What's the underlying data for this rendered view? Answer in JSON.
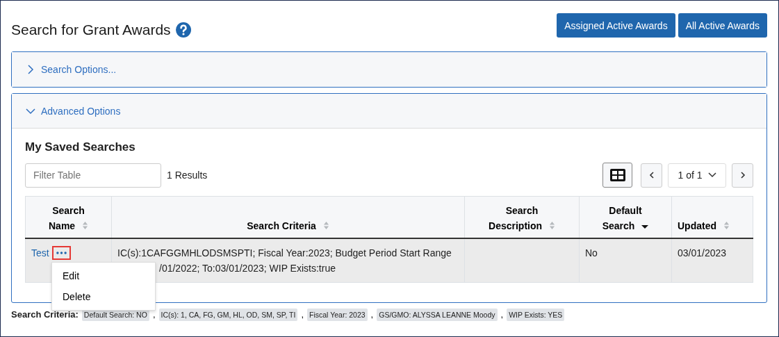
{
  "page": {
    "title": "Search for Grant Awards"
  },
  "header_buttons": [
    "Assigned Active Awards",
    "All Active Awards"
  ],
  "panels": [
    {
      "title": "Search Options...",
      "expanded": false
    },
    {
      "title": "Advanced Options",
      "expanded": true
    }
  ],
  "saved_searches": {
    "title": "My Saved Searches",
    "filter": {
      "placeholder": "Filter Table"
    },
    "results": "1 Results",
    "pager": "1 of 1",
    "columns": [
      {
        "label": "Search Name",
        "sorted_descending": false
      },
      {
        "label": "Search Criteria",
        "sorted_descending": false
      },
      {
        "label": "Search Description",
        "sorted_descending": false
      },
      {
        "label": "Default Search",
        "sorted_descending": true
      },
      {
        "label": "Updated",
        "sorted_descending": false
      }
    ],
    "rows": [
      {
        "name": "Test",
        "criteria": [
          "IC(s):1CAFGGMHLODSMSPTI; Fiscal Year:2023; Budget Period Start Range",
          "/01/2022; To:03/01/2023; WIP Exists:true"
        ],
        "default": "No",
        "updated": "03/01/2023"
      }
    ],
    "row_menu": {
      "open": true,
      "items": [
        "Edit",
        "Delete"
      ]
    }
  },
  "search_criteria": {
    "label": "Search Criteria:",
    "tags": [
      "Default Search: NO",
      "IC(s): 1, CA, FG, GM, HL, OD, SM, SP, TI",
      "Fiscal Year: 2023",
      "GS/GMO: ALYSSA LEANNE Moody",
      "WIP Exists: YES"
    ],
    "separator": ","
  }
}
